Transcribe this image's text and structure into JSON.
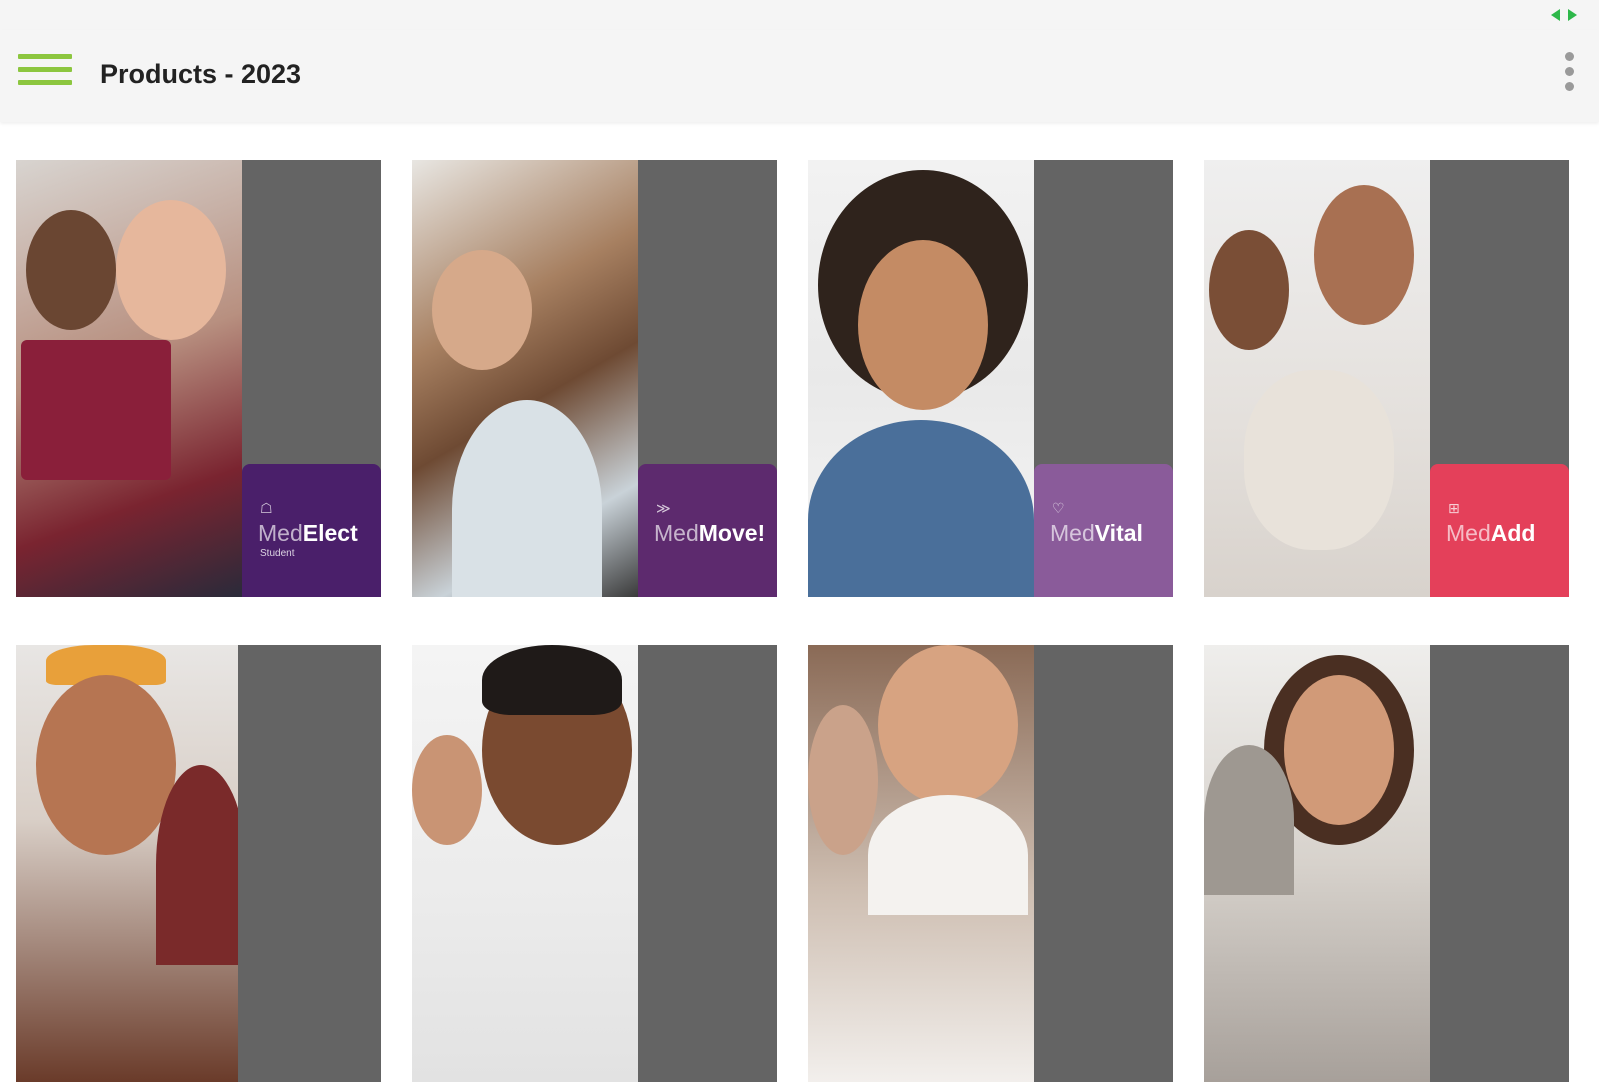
{
  "app": {
    "title": "Products - 2023"
  },
  "colors": {
    "menu_icon": "#8cc63f",
    "battery": "#2eb84a",
    "side_panel": "#646464",
    "medelect": "#4a1f6a",
    "medmove": "#5d2a6e",
    "medvital": "#8a5b9a",
    "medadd": "#e4405a"
  },
  "products": [
    {
      "logo_light": "Med",
      "logo_bold": "Elect",
      "sub": "Student",
      "icon": "graduation-cap-icon",
      "symbol": "☖",
      "badge_color": "#4a1f6a"
    },
    {
      "logo_light": "Med",
      "logo_bold": "Move!",
      "sub": "",
      "icon": "chevron-forward-icon",
      "symbol": "≫",
      "badge_color": "#5d2a6e"
    },
    {
      "logo_light": "Med",
      "logo_bold": "Vital",
      "sub": "",
      "icon": "heart-outline-icon",
      "symbol": "♡",
      "badge_color": "#8a5b9a"
    },
    {
      "logo_light": "Med",
      "logo_bold": "Add",
      "sub": "",
      "icon": "plus-square-icon",
      "symbol": "⊞",
      "badge_color": "#e4405a"
    },
    {
      "logo_light": "",
      "logo_bold": "",
      "sub": "",
      "icon": "",
      "symbol": "",
      "badge_color": ""
    },
    {
      "logo_light": "",
      "logo_bold": "",
      "sub": "",
      "icon": "",
      "symbol": "",
      "badge_color": ""
    },
    {
      "logo_light": "",
      "logo_bold": "",
      "sub": "",
      "icon": "",
      "symbol": "",
      "badge_color": ""
    },
    {
      "logo_light": "",
      "logo_bold": "",
      "sub": "",
      "icon": "",
      "symbol": "",
      "badge_color": ""
    }
  ]
}
